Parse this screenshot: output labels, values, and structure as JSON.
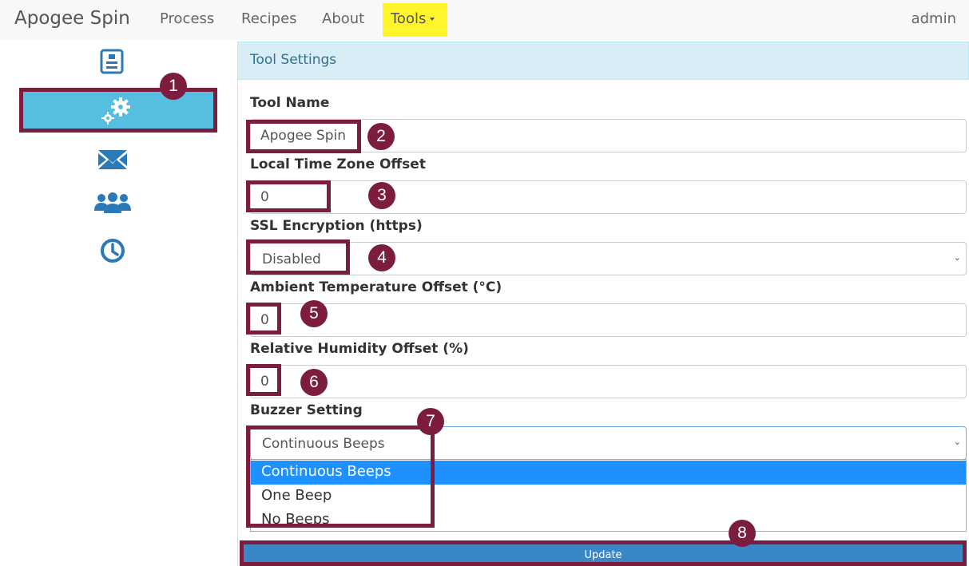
{
  "navbar": {
    "brand": "Apogee Spin",
    "links": [
      "Process",
      "Recipes",
      "About"
    ],
    "tools_label": "Tools",
    "user": "admin",
    "highlight_color": "#fff52a"
  },
  "sidebar": {
    "items": [
      {
        "icon": "document-icon"
      },
      {
        "icon": "gears-icon",
        "active": true
      },
      {
        "icon": "envelope-icon"
      },
      {
        "icon": "users-icon"
      },
      {
        "icon": "clock-icon"
      }
    ],
    "active_color": "#56bfe1"
  },
  "panel": {
    "title": "Tool Settings",
    "fields": {
      "tool_name": {
        "label": "Tool Name",
        "value": "Apogee Spin"
      },
      "tz_offset": {
        "label": "Local Time Zone Offset",
        "value": "0"
      },
      "ssl": {
        "label": "SSL Encryption (https)",
        "value": "Disabled"
      },
      "ambient_temp": {
        "label": "Ambient Temperature Offset (°C)",
        "value": "0"
      },
      "humidity": {
        "label": "Relative Humidity Offset (%)",
        "value": "0"
      },
      "buzzer": {
        "label": "Buzzer Setting",
        "value": "Continuous Beeps",
        "options": [
          "Continuous Beeps",
          "One Beep",
          "No Beeps"
        ]
      }
    },
    "update_label": "Update"
  },
  "annotations": {
    "markers": [
      "1",
      "2",
      "3",
      "4",
      "5",
      "6",
      "7",
      "8"
    ],
    "color": "#7c1d40"
  }
}
